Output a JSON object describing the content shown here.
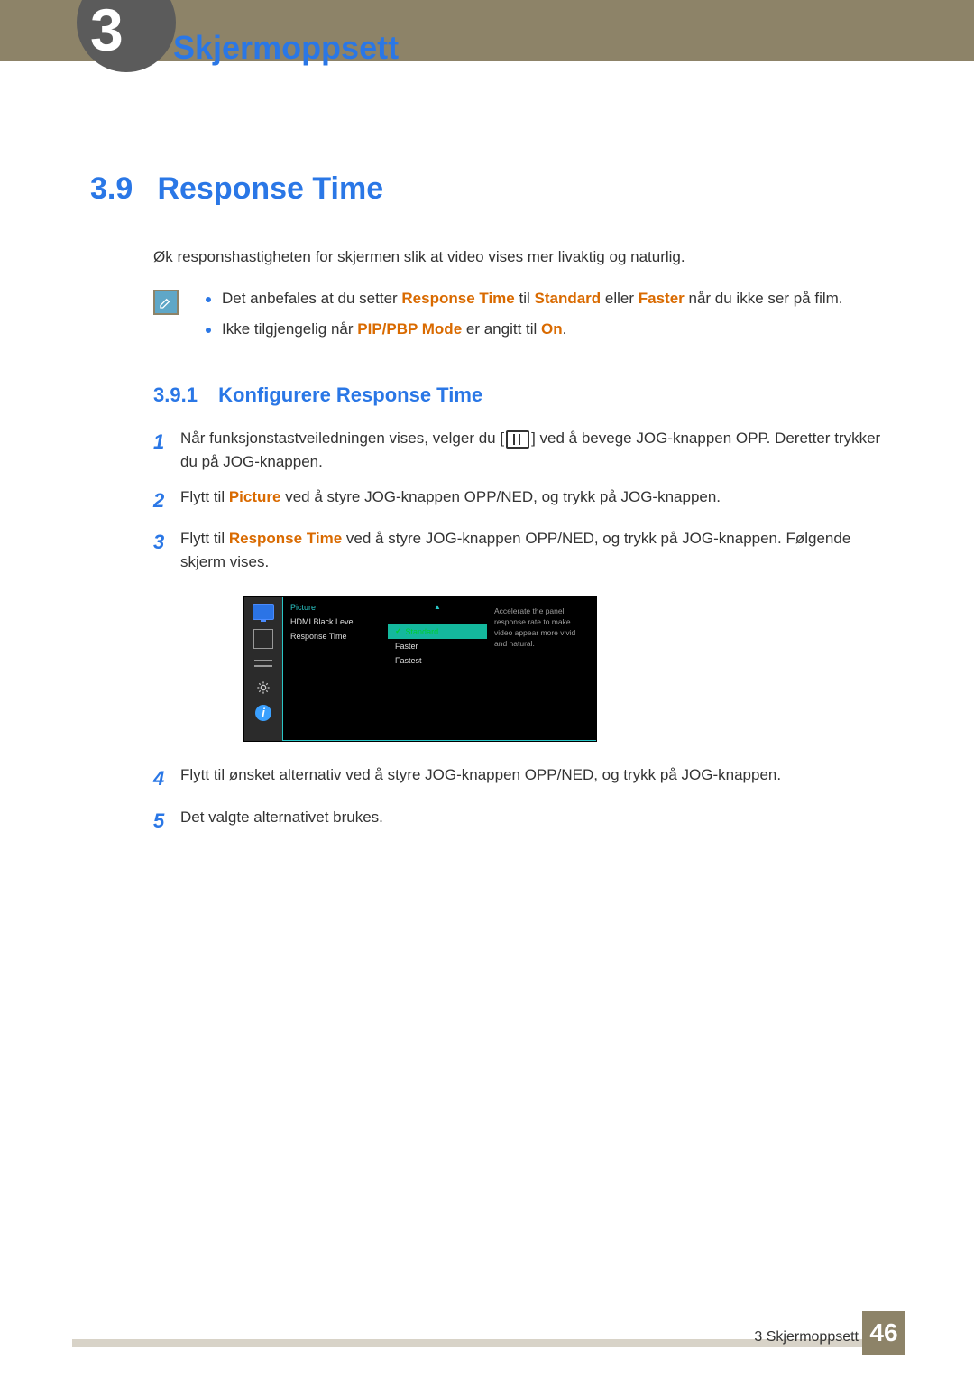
{
  "chapter": {
    "number": "3",
    "title": "Skjermoppsett"
  },
  "section": {
    "number": "3.9",
    "title": "Response Time"
  },
  "intro": "Øk responshastigheten for skjermen slik at video vises mer livaktig og naturlig.",
  "notes": {
    "item1": {
      "pre": "Det anbefales at du setter ",
      "hl1": "Response Time",
      "mid1": " til ",
      "hl2": "Standard",
      "mid2": " eller ",
      "hl3": "Faster",
      "post": " når du ikke ser på film."
    },
    "item2": {
      "pre": "Ikke tilgjengelig når ",
      "hl1": "PIP/PBP Mode",
      "mid": " er angitt til ",
      "hl2": "On",
      "post": "."
    }
  },
  "subsection": {
    "number": "3.9.1",
    "title": "Konfigurere Response Time"
  },
  "steps": {
    "s1": {
      "num": "1",
      "part1": "Når funksjonstastveiledningen vises, velger du [",
      "part2": "] ved å bevege JOG-knappen OPP. Deretter trykker du på JOG-knappen."
    },
    "s2": {
      "num": "2",
      "pre": "Flytt til ",
      "hl": "Picture",
      "post": " ved å styre JOG-knappen OPP/NED, og trykk på JOG-knappen."
    },
    "s3": {
      "num": "3",
      "pre": "Flytt til ",
      "hl": "Response Time",
      "post": " ved å styre JOG-knappen OPP/NED, og trykk på JOG-knappen. Følgende skjerm vises."
    },
    "s4": {
      "num": "4",
      "text": "Flytt til ønsket alternativ ved å styre JOG-knappen OPP/NED, og trykk på JOG-knappen."
    },
    "s5": {
      "num": "5",
      "text": "Det valgte alternativet brukes."
    }
  },
  "osd": {
    "menu_header": "Picture",
    "row1": "HDMI Black Level",
    "row2": "Response Time",
    "opt_sel": "Standard",
    "opt2": "Faster",
    "opt3": "Fastest",
    "desc": "Accelerate the panel response rate to make video appear more vivid and natural.",
    "arrow_up": "▲"
  },
  "footer": {
    "breadcrumb": "3 Skjermoppsett",
    "page": "46"
  }
}
